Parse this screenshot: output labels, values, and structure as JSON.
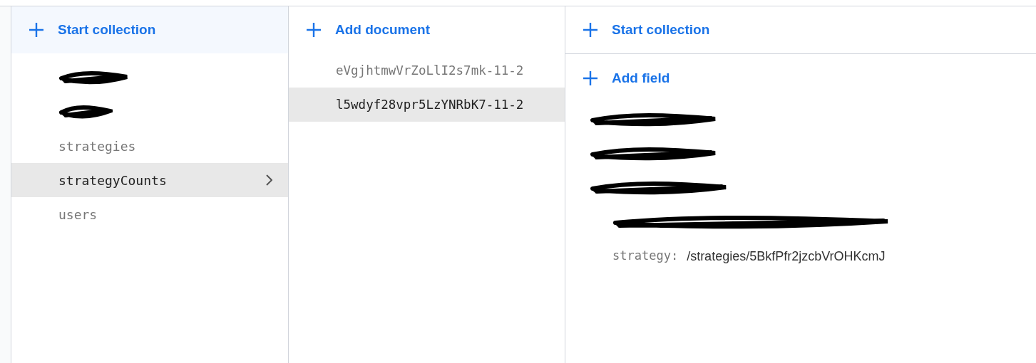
{
  "collections_panel": {
    "action": "Start collection",
    "items": [
      {
        "redacted": true,
        "selected": false
      },
      {
        "redacted": true,
        "selected": false
      },
      {
        "redacted": false,
        "name": "strategies",
        "selected": false
      },
      {
        "redacted": false,
        "name": "strategyCounts",
        "selected": true
      },
      {
        "redacted": false,
        "name": "users",
        "selected": false
      }
    ]
  },
  "documents_panel": {
    "action": "Add document",
    "items": [
      {
        "name": "eVgjhtmwVrZoLlI2s7mk-11-2",
        "selected": false
      },
      {
        "name": "l5wdyf28vpr5LzYNRbK7-11-2",
        "selected": true
      }
    ]
  },
  "fields_panel": {
    "action": "Start collection",
    "add_field": "Add field",
    "fields": [
      {
        "redacted": true
      },
      {
        "redacted": true
      },
      {
        "redacted": true
      },
      {
        "redacted": true
      },
      {
        "redacted": false,
        "key": "strategy:",
        "value": "/strategies/5BkfPfr2jzcbVrOHKcmJ"
      }
    ]
  }
}
